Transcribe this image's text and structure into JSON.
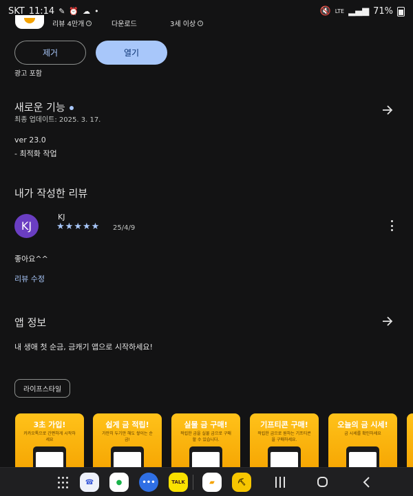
{
  "status_bar": {
    "carrier": "SKT",
    "time": "11:14",
    "signal": "LTE",
    "battery": "71%"
  },
  "app_meta": {
    "reviews": "리뷰 4만개",
    "downloads": "다운로드",
    "age": "3세 이상"
  },
  "actions": {
    "remove_label": "제거",
    "open_label": "열기",
    "ads_note": "광고 포함"
  },
  "whats_new": {
    "title": "새로운 기능",
    "updated": "최종 업데이트: 2025. 3. 17.",
    "version": "ver 23.0",
    "notes": "- 최적화 작업"
  },
  "my_review": {
    "title": "내가 작성한 리뷰",
    "avatar_initials": "KJ",
    "reviewer": "KJ",
    "rating": 5,
    "date": "25/4/9",
    "text": "좋아요^^",
    "edit_label": "리뷰 수정"
  },
  "app_info": {
    "title": "앱 정보",
    "description": "내 생애 첫 순금, 금캐기 앱으로 시작하세요!",
    "category_chip": "라이프스타일"
  },
  "screenshots": [
    {
      "title": "3초 가입!",
      "sub": "카카오톡으로 간편하게 시작하세요"
    },
    {
      "title": "쉽게 금 적립!",
      "sub": "가만히 두기만 해도 쌓이는 순금!"
    },
    {
      "title": "실물 금 구매!",
      "sub": "적립한 금을 실물 금으로 구매 할 수 있습니다."
    },
    {
      "title": "기프티콘 구매!",
      "sub": "적립한 금으로 원하는 기프티콘을 구매하세요."
    },
    {
      "title": "오늘의 금 시세!",
      "sub": "금 시세를 확인하세요"
    }
  ],
  "navbar": {
    "kakaotalk_label": "TALK"
  },
  "colors": {
    "background": "#131314",
    "accent": "#a8c7fa",
    "avatar": "#6a3ec2",
    "screenshot_bg": "#f5a300"
  }
}
